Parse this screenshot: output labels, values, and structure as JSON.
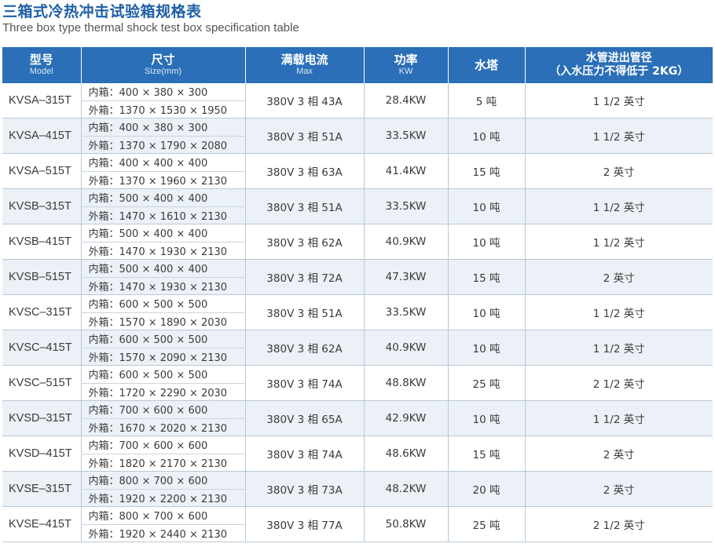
{
  "title_zh": "三箱式冷热冲击试验箱规格表",
  "title_en": "Three box type thermal shock test box specification table",
  "headers": {
    "model_zh": "型号",
    "model_en": "Model",
    "size_zh": "尺寸",
    "size_en": "Size(mm)",
    "current_zh": "满载电流",
    "current_en": "Max",
    "power_zh": "功率",
    "power_en": "KW",
    "tower_zh": "水塔",
    "pipe_zh": "水管进出管径",
    "pipe_note": "（入水压力不得低于 2KG）"
  },
  "rows": [
    {
      "model": "KVSA–315T",
      "inner": "内箱：400 × 380 × 300",
      "outer": "外箱：1370 × 1530 × 1950",
      "current": "380V 3 相  43A",
      "power": "28.4KW",
      "tower": "5 吨",
      "pipe": "1 1/2 英寸"
    },
    {
      "model": "KVSA–415T",
      "inner": "内箱：400 × 380 × 300",
      "outer": "外箱：1370 × 1790 × 2080",
      "current": "380V 3 相  51A",
      "power": "33.5KW",
      "tower": "10 吨",
      "pipe": "1 1/2 英寸"
    },
    {
      "model": "KVSA–515T",
      "inner": "内箱：400 × 400 × 400",
      "outer": "外箱：1370 × 1960 × 2130",
      "current": "380V 3 相  63A",
      "power": "41.4KW",
      "tower": "15 吨",
      "pipe": "2 英寸"
    },
    {
      "model": "KVSB–315T",
      "inner": "内箱：500 × 400 × 400",
      "outer": "外箱：1470 × 1610 × 2130",
      "current": "380V 3 相  51A",
      "power": "33.5KW",
      "tower": "10 吨",
      "pipe": "1 1/2 英寸"
    },
    {
      "model": "KVSB–415T",
      "inner": "内箱：500 × 400 × 400",
      "outer": "外箱：1470 × 1930 × 2130",
      "current": "380V 3 相  62A",
      "power": "40.9KW",
      "tower": "10 吨",
      "pipe": "1 1/2 英寸"
    },
    {
      "model": "KVSB–515T",
      "inner": "内箱：500 × 400 × 400",
      "outer": "外箱：1470 × 1930 × 2130",
      "current": "380V 3 相  72A",
      "power": "47.3KW",
      "tower": "15 吨",
      "pipe": "2 英寸"
    },
    {
      "model": "KVSC–315T",
      "inner": "内箱：600 × 500 × 500",
      "outer": "外箱：1570 × 1890 × 2030",
      "current": "380V 3 相  51A",
      "power": "33.5KW",
      "tower": "10 吨",
      "pipe": "1 1/2 英寸"
    },
    {
      "model": "KVSC–415T",
      "inner": "内箱：600 × 500 × 500",
      "outer": "外箱：1570 × 2090 × 2130",
      "current": "380V 3 相  62A",
      "power": "40.9KW",
      "tower": "10 吨",
      "pipe": "1 1/2 英寸"
    },
    {
      "model": "KVSC–515T",
      "inner": "内箱：600 × 500 × 500",
      "outer": "外箱：1720 × 2290 × 2030",
      "current": "380V 3 相  74A",
      "power": "48.8KW",
      "tower": "25 吨",
      "pipe": "2 1/2 英寸"
    },
    {
      "model": "KVSD–315T",
      "inner": "内箱：700 × 600 × 600",
      "outer": "外箱：1670 × 2020 × 2130",
      "current": "380V 3 相  65A",
      "power": "42.9KW",
      "tower": "10 吨",
      "pipe": "1 1/2 英寸"
    },
    {
      "model": "KVSD–415T",
      "inner": "内箱：700 × 600 × 600",
      "outer": "外箱：1820 × 2170 × 2130",
      "current": "380V 3 相  74A",
      "power": "48.6KW",
      "tower": "15 吨",
      "pipe": "2 英寸"
    },
    {
      "model": "KVSE–315T",
      "inner": "内箱：800 × 700 × 600",
      "outer": "外箱：1920 × 2200 × 2130",
      "current": "380V 3 相  73A",
      "power": "48.2KW",
      "tower": "20 吨",
      "pipe": "2 英寸"
    },
    {
      "model": "KVSE–415T",
      "inner": "内箱：800 × 700 × 600",
      "outer": "外箱：1920 × 2440 × 2130",
      "current": "380V 3 相  77A",
      "power": "50.8KW",
      "tower": "25 吨",
      "pipe": "2 1/2 英寸"
    }
  ],
  "colors": {
    "header_bg": "#2a6fb7",
    "alt_row_bg": "#ebf1f7",
    "title": "#1d5fa6"
  }
}
